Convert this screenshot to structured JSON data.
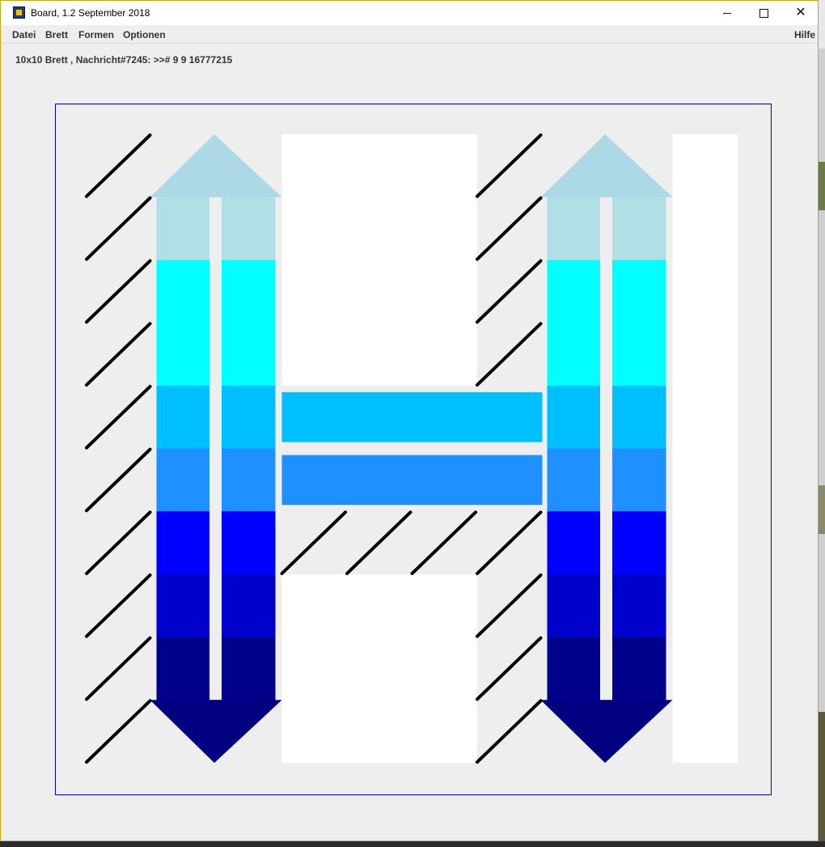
{
  "window": {
    "title": "Board, 1.2 September 2018",
    "icon": "board-app-icon",
    "controls": {
      "minimize": "minimize-icon",
      "maximize": "maximize-icon",
      "close": "close-icon",
      "close_glyph": "✕"
    }
  },
  "menu": {
    "datei": "Datei",
    "brett": "Brett",
    "formen": "Formen",
    "optionen": "Optionen",
    "hilfe": "Hilfe"
  },
  "status": {
    "text": "10x10 Brett , Nachricht#7245: >># 9 9 16777215"
  },
  "board": {
    "rows": 10,
    "cols": 10,
    "frame_color": "#0000aa",
    "background": "#eeeeee",
    "hatch_color": "#000000",
    "arrow_colors": [
      "#add8e6",
      "#b0e0e6",
      "#00ffff",
      "#00ffff",
      "#00bfff",
      "#1e90ff",
      "#0000ff",
      "#0000cd",
      "#00008b",
      "#000080"
    ],
    "horizontal_bars": [
      "#00bfff",
      "#1e90ff"
    ],
    "white_color": "#ffffff"
  }
}
